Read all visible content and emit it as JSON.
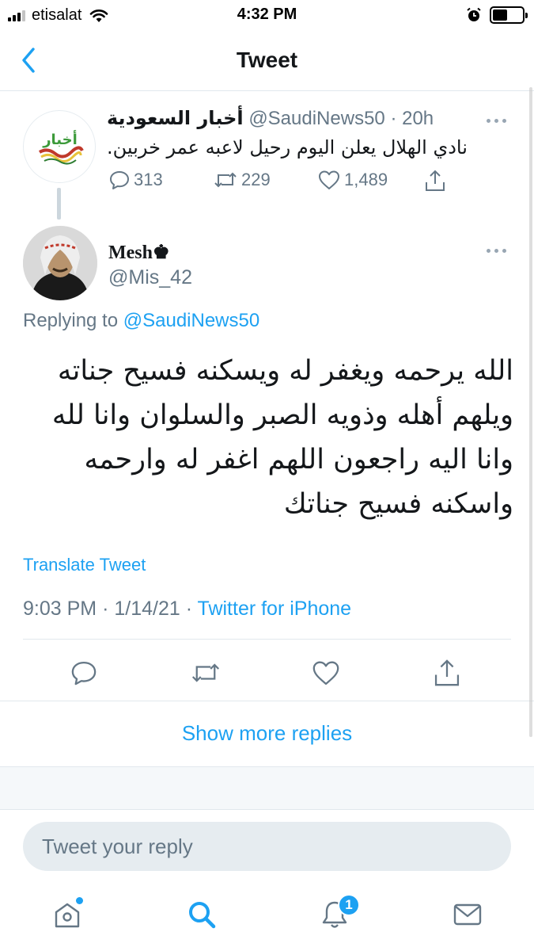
{
  "status_bar": {
    "carrier": "etisalat",
    "time": "4:32 PM",
    "battery_level": 0.5
  },
  "nav": {
    "title": "Tweet"
  },
  "parent_tweet": {
    "display_name": "أخبار السعودية",
    "handle": "@SaudiNews50",
    "time_ago": "20h",
    "text": "نادي الهلال يعلن اليوم رحيل لاعبه عمر خربين.",
    "avatar_logo_text": "أخبار",
    "replies": "313",
    "retweets": "229",
    "likes": "1,489"
  },
  "reply_tweet": {
    "display_name": "Mesh♚",
    "handle": "@Mis_42",
    "replying_prefix": "Replying to",
    "replying_to": "@SaudiNews50",
    "text": "الله يرحمه ويغفر له ويسكنه فسيح جناته ويلهم أهله وذويه الصبر والسلوان وانا لله وانا اليه راجعون اللهم اغفر له وارحمه واسكنه فسيح جناتك",
    "translate_label": "Translate Tweet",
    "time": "9:03 PM",
    "date": "1/14/21",
    "source": "Twitter for iPhone"
  },
  "show_more_label": "Show more replies",
  "compose": {
    "placeholder": "Tweet your reply"
  },
  "tab_bar": {
    "notifications_count": "1"
  },
  "colors": {
    "accent": "#1da1f2",
    "secondary_text": "#657786",
    "divider": "#e1e8ed"
  }
}
